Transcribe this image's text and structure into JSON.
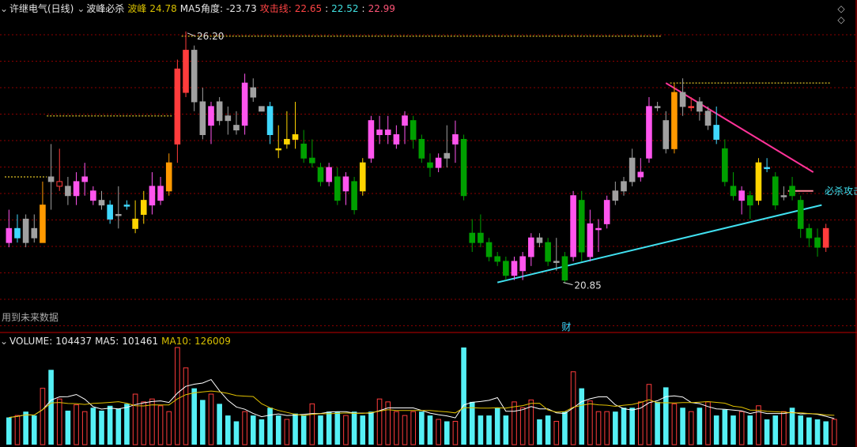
{
  "header": {
    "expand_icon": "chevron-down-icon",
    "stock_name": "许继电气(日线)",
    "indicator_name": "波峰必杀",
    "bofeng_label": "波峰",
    "bofeng_value": "24.78",
    "ma5_label": "MA5角度:",
    "ma5_value": "-23.73",
    "attack_label": "攻击线:",
    "attack_v1": "22.65",
    "attack_v2": "22.52",
    "attack_v3": "22.99"
  },
  "volume_header": {
    "volume_label": "VOLUME:",
    "volume_value": "104437",
    "ma5_label": "MA5:",
    "ma5_value": "101461",
    "ma10_label": "MA10:",
    "ma10_value": "126009"
  },
  "note_text": "用到未来数据",
  "nav": {
    "up": "◇",
    "down": "◇"
  },
  "colors": {
    "up": "#ff3c3c",
    "down": "#00a000",
    "gray": "#a0a0a0",
    "magenta": "#ff55ee",
    "cyan": "#40d8ff",
    "yellow": "#ffd400",
    "orange": "#ff9900",
    "grid": "#8b0000",
    "trend_down": "#ff3399",
    "trend_up": "#40e0f0",
    "level": "#b8a020"
  },
  "chart_data": {
    "type": "candlestick",
    "title": "许继电气(日线)",
    "ylim": [
      19.8,
      26.5
    ],
    "annotations": {
      "high_label": "26.20",
      "low_label": "20.85",
      "cai_label": "财",
      "bisha_label": "必杀攻击"
    },
    "candles": [
      {
        "o": 22.0,
        "h": 22.4,
        "l": 21.6,
        "c": 21.7,
        "t": "magenta"
      },
      {
        "o": 21.8,
        "h": 22.3,
        "l": 21.7,
        "c": 22.0,
        "t": "cyan"
      },
      {
        "o": 21.7,
        "h": 22.3,
        "l": 21.6,
        "c": 22.2,
        "t": "gray"
      },
      {
        "o": 21.8,
        "h": 22.3,
        "l": 21.7,
        "c": 22.0,
        "t": "gray"
      },
      {
        "o": 21.7,
        "h": 23.0,
        "l": 21.7,
        "c": 22.5,
        "t": "orange"
      },
      {
        "o": 23.1,
        "h": 23.8,
        "l": 22.4,
        "c": 23.0,
        "t": "gray"
      },
      {
        "o": 23.0,
        "h": 23.7,
        "l": 22.8,
        "c": 22.9,
        "t": "up"
      },
      {
        "o": 22.9,
        "h": 23.1,
        "l": 22.5,
        "c": 22.7,
        "t": "gray"
      },
      {
        "o": 22.7,
        "h": 23.2,
        "l": 22.5,
        "c": 23.0,
        "t": "magenta"
      },
      {
        "o": 23.0,
        "h": 23.4,
        "l": 22.7,
        "c": 23.1,
        "t": "magenta"
      },
      {
        "o": 22.8,
        "h": 22.9,
        "l": 22.5,
        "c": 22.6,
        "t": "magenta"
      },
      {
        "o": 22.6,
        "h": 22.8,
        "l": 22.4,
        "c": 22.5,
        "t": "gray"
      },
      {
        "o": 22.5,
        "h": 22.6,
        "l": 22.1,
        "c": 22.2,
        "t": "cyan"
      },
      {
        "o": 22.3,
        "h": 22.9,
        "l": 22.0,
        "c": 22.3,
        "t": "gray"
      },
      {
        "o": 22.5,
        "h": 22.6,
        "l": 22.4,
        "c": 22.5,
        "t": "cyan"
      },
      {
        "o": 22.0,
        "h": 22.6,
        "l": 21.9,
        "c": 22.2,
        "t": "yellow"
      },
      {
        "o": 22.3,
        "h": 22.8,
        "l": 22.1,
        "c": 22.6,
        "t": "yellow"
      },
      {
        "o": 22.5,
        "h": 23.2,
        "l": 22.3,
        "c": 22.9,
        "t": "magenta"
      },
      {
        "o": 22.6,
        "h": 23.1,
        "l": 22.5,
        "c": 22.9,
        "t": "magenta"
      },
      {
        "o": 22.8,
        "h": 23.6,
        "l": 22.7,
        "c": 23.4,
        "t": "orange"
      },
      {
        "o": 23.8,
        "h": 25.6,
        "l": 23.4,
        "c": 25.4,
        "t": "up"
      },
      {
        "o": 24.9,
        "h": 26.2,
        "l": 24.8,
        "c": 25.8,
        "t": "up"
      },
      {
        "o": 25.8,
        "h": 25.9,
        "l": 24.5,
        "c": 24.7,
        "t": "gray"
      },
      {
        "o": 24.7,
        "h": 25.0,
        "l": 23.9,
        "c": 24.0,
        "t": "gray"
      },
      {
        "o": 24.2,
        "h": 24.7,
        "l": 23.8,
        "c": 24.6,
        "t": "magenta"
      },
      {
        "o": 24.7,
        "h": 24.8,
        "l": 24.2,
        "c": 24.3,
        "t": "gray"
      },
      {
        "o": 24.3,
        "h": 24.6,
        "l": 24.0,
        "c": 24.4,
        "t": "gray"
      },
      {
        "o": 24.2,
        "h": 24.5,
        "l": 24.0,
        "c": 24.1,
        "t": "gray"
      },
      {
        "o": 24.2,
        "h": 25.3,
        "l": 24.0,
        "c": 25.1,
        "t": "magenta"
      },
      {
        "o": 25.0,
        "h": 25.2,
        "l": 24.7,
        "c": 24.8,
        "t": "gray"
      },
      {
        "o": 24.6,
        "h": 24.6,
        "l": 24.5,
        "c": 24.5,
        "t": "gray"
      },
      {
        "o": 24.6,
        "h": 24.7,
        "l": 23.8,
        "c": 24.0,
        "t": "cyan"
      },
      {
        "o": 23.7,
        "h": 24.2,
        "l": 23.5,
        "c": 23.7,
        "t": "yellow"
      },
      {
        "o": 23.8,
        "h": 24.5,
        "l": 23.7,
        "c": 23.9,
        "t": "yellow"
      },
      {
        "o": 23.9,
        "h": 24.7,
        "l": 23.7,
        "c": 24.0,
        "t": "yellow"
      },
      {
        "o": 23.8,
        "h": 24.1,
        "l": 23.4,
        "c": 23.5,
        "t": "down"
      },
      {
        "o": 23.5,
        "h": 23.9,
        "l": 23.3,
        "c": 23.4,
        "t": "down"
      },
      {
        "o": 23.3,
        "h": 23.4,
        "l": 22.9,
        "c": 23.0,
        "t": "down"
      },
      {
        "o": 23.0,
        "h": 23.4,
        "l": 22.9,
        "c": 23.3,
        "t": "magenta"
      },
      {
        "o": 23.1,
        "h": 23.3,
        "l": 22.5,
        "c": 22.6,
        "t": "down"
      },
      {
        "o": 22.8,
        "h": 23.2,
        "l": 22.5,
        "c": 23.1,
        "t": "magenta"
      },
      {
        "o": 23.0,
        "h": 23.1,
        "l": 22.3,
        "c": 22.4,
        "t": "down"
      },
      {
        "o": 22.8,
        "h": 23.5,
        "l": 22.7,
        "c": 23.4,
        "t": "yellow"
      },
      {
        "o": 23.5,
        "h": 24.4,
        "l": 23.4,
        "c": 24.3,
        "t": "magenta"
      },
      {
        "o": 24.1,
        "h": 24.4,
        "l": 23.8,
        "c": 24.0,
        "t": "magenta"
      },
      {
        "o": 24.0,
        "h": 24.4,
        "l": 23.8,
        "c": 24.1,
        "t": "magenta"
      },
      {
        "o": 24.0,
        "h": 24.2,
        "l": 23.7,
        "c": 23.8,
        "t": "magenta"
      },
      {
        "o": 24.2,
        "h": 24.5,
        "l": 23.8,
        "c": 24.4,
        "t": "magenta"
      },
      {
        "o": 24.3,
        "h": 24.4,
        "l": 23.7,
        "c": 23.9,
        "t": "down"
      },
      {
        "o": 23.9,
        "h": 24.0,
        "l": 23.4,
        "c": 23.5,
        "t": "down"
      },
      {
        "o": 23.4,
        "h": 23.6,
        "l": 23.1,
        "c": 23.3,
        "t": "down"
      },
      {
        "o": 23.3,
        "h": 23.6,
        "l": 23.2,
        "c": 23.5,
        "t": "magenta"
      },
      {
        "o": 23.5,
        "h": 24.2,
        "l": 23.3,
        "c": 23.6,
        "t": "gray"
      },
      {
        "o": 24.0,
        "h": 24.3,
        "l": 23.4,
        "c": 23.8,
        "t": "magenta"
      },
      {
        "o": 23.9,
        "h": 24.0,
        "l": 22.6,
        "c": 22.7,
        "t": "down"
      },
      {
        "o": 21.9,
        "h": 22.2,
        "l": 21.5,
        "c": 21.7,
        "t": "down"
      },
      {
        "o": 21.9,
        "h": 22.3,
        "l": 21.6,
        "c": 21.7,
        "t": "down"
      },
      {
        "o": 21.7,
        "h": 21.8,
        "l": 21.3,
        "c": 21.4,
        "t": "down"
      },
      {
        "o": 21.4,
        "h": 21.5,
        "l": 21.2,
        "c": 21.3,
        "t": "down"
      },
      {
        "o": 21.3,
        "h": 21.4,
        "l": 20.9,
        "c": 21.0,
        "t": "down"
      },
      {
        "o": 21.0,
        "h": 21.4,
        "l": 20.9,
        "c": 21.3,
        "t": "magenta"
      },
      {
        "o": 21.1,
        "h": 21.5,
        "l": 20.9,
        "c": 21.4,
        "t": "magenta"
      },
      {
        "o": 21.4,
        "h": 21.9,
        "l": 21.2,
        "c": 21.8,
        "t": "magenta"
      },
      {
        "o": 21.8,
        "h": 21.9,
        "l": 21.6,
        "c": 21.7,
        "t": "gray"
      },
      {
        "o": 21.7,
        "h": 21.8,
        "l": 21.2,
        "c": 21.3,
        "t": "down"
      },
      {
        "o": 21.3,
        "h": 21.8,
        "l": 21.1,
        "c": 21.3,
        "t": "gray"
      },
      {
        "o": 21.4,
        "h": 21.5,
        "l": 20.85,
        "c": 20.9,
        "t": "down"
      },
      {
        "o": 21.4,
        "h": 22.8,
        "l": 21.3,
        "c": 22.7,
        "t": "magenta"
      },
      {
        "o": 22.6,
        "h": 22.8,
        "l": 21.3,
        "c": 21.5,
        "t": "down"
      },
      {
        "o": 21.4,
        "h": 22.4,
        "l": 21.3,
        "c": 22.1,
        "t": "magenta"
      },
      {
        "o": 22.0,
        "h": 22.2,
        "l": 21.5,
        "c": 22.0,
        "t": "magenta"
      },
      {
        "o": 22.1,
        "h": 22.7,
        "l": 22.0,
        "c": 22.6,
        "t": "magenta"
      },
      {
        "o": 22.6,
        "h": 23.0,
        "l": 22.5,
        "c": 22.8,
        "t": "gray"
      },
      {
        "o": 22.8,
        "h": 23.1,
        "l": 22.7,
        "c": 23.0,
        "t": "gray"
      },
      {
        "o": 23.0,
        "h": 23.7,
        "l": 22.9,
        "c": 23.5,
        "t": "gray"
      },
      {
        "o": 23.1,
        "h": 23.5,
        "l": 23.0,
        "c": 23.2,
        "t": "magenta"
      },
      {
        "o": 23.5,
        "h": 24.8,
        "l": 23.4,
        "c": 24.6,
        "t": "magenta"
      },
      {
        "o": 24.6,
        "h": 24.7,
        "l": 24.5,
        "c": 24.6,
        "t": "gray"
      },
      {
        "o": 23.7,
        "h": 24.5,
        "l": 23.6,
        "c": 24.3,
        "t": "gray"
      },
      {
        "o": 23.7,
        "h": 25.1,
        "l": 23.6,
        "c": 24.9,
        "t": "orange"
      },
      {
        "o": 24.9,
        "h": 25.2,
        "l": 24.4,
        "c": 24.6,
        "t": "gray"
      },
      {
        "o": 24.6,
        "h": 24.8,
        "l": 24.5,
        "c": 24.6,
        "t": "up"
      },
      {
        "o": 24.7,
        "h": 24.8,
        "l": 24.3,
        "c": 24.5,
        "t": "gray"
      },
      {
        "o": 24.5,
        "h": 24.6,
        "l": 24.1,
        "c": 24.2,
        "t": "gray"
      },
      {
        "o": 24.2,
        "h": 24.6,
        "l": 23.8,
        "c": 23.9,
        "t": "cyan"
      },
      {
        "o": 23.7,
        "h": 23.9,
        "l": 22.9,
        "c": 23.0,
        "t": "down"
      },
      {
        "o": 22.9,
        "h": 23.2,
        "l": 22.6,
        "c": 22.7,
        "t": "down"
      },
      {
        "o": 22.6,
        "h": 22.9,
        "l": 22.3,
        "c": 22.8,
        "t": "magenta"
      },
      {
        "o": 22.7,
        "h": 22.8,
        "l": 22.2,
        "c": 22.5,
        "t": "down"
      },
      {
        "o": 22.6,
        "h": 23.5,
        "l": 22.5,
        "c": 23.4,
        "t": "yellow"
      },
      {
        "o": 23.3,
        "h": 23.5,
        "l": 23.2,
        "c": 23.3,
        "t": "cyan"
      },
      {
        "o": 23.1,
        "h": 23.2,
        "l": 22.4,
        "c": 22.5,
        "t": "down"
      },
      {
        "o": 22.7,
        "h": 22.9,
        "l": 22.6,
        "c": 22.7,
        "t": "gray"
      },
      {
        "o": 22.9,
        "h": 23.1,
        "l": 22.6,
        "c": 22.7,
        "t": "down"
      },
      {
        "o": 22.6,
        "h": 22.7,
        "l": 21.8,
        "c": 22.0,
        "t": "down"
      },
      {
        "o": 22.0,
        "h": 22.1,
        "l": 21.6,
        "c": 21.8,
        "t": "down"
      },
      {
        "o": 21.8,
        "h": 22.0,
        "l": 21.4,
        "c": 21.6,
        "t": "down"
      },
      {
        "o": 21.6,
        "h": 22.1,
        "l": 21.5,
        "c": 22.0,
        "t": "up"
      }
    ],
    "volume": [
      {
        "v": 0.28,
        "t": "cyan"
      },
      {
        "v": 0.3,
        "t": "up"
      },
      {
        "v": 0.34,
        "t": "cyan"
      },
      {
        "v": 0.3,
        "t": "cyan"
      },
      {
        "v": 0.58,
        "t": "up"
      },
      {
        "v": 0.77,
        "t": "cyan"
      },
      {
        "v": 0.47,
        "t": "up"
      },
      {
        "v": 0.35,
        "t": "cyan"
      },
      {
        "v": 0.41,
        "t": "up"
      },
      {
        "v": 0.34,
        "t": "up"
      },
      {
        "v": 0.38,
        "t": "cyan"
      },
      {
        "v": 0.35,
        "t": "cyan"
      },
      {
        "v": 0.4,
        "t": "cyan"
      },
      {
        "v": 0.37,
        "t": "cyan"
      },
      {
        "v": 0.42,
        "t": "cyan"
      },
      {
        "v": 0.52,
        "t": "up"
      },
      {
        "v": 0.44,
        "t": "up"
      },
      {
        "v": 0.47,
        "t": "up"
      },
      {
        "v": 0.4,
        "t": "up"
      },
      {
        "v": 0.34,
        "t": "up"
      },
      {
        "v": 1.0,
        "t": "up"
      },
      {
        "v": 0.79,
        "t": "up"
      },
      {
        "v": 0.58,
        "t": "cyan"
      },
      {
        "v": 0.46,
        "t": "cyan"
      },
      {
        "v": 0.52,
        "t": "up"
      },
      {
        "v": 0.42,
        "t": "cyan"
      },
      {
        "v": 0.3,
        "t": "cyan"
      },
      {
        "v": 0.24,
        "t": "cyan"
      },
      {
        "v": 0.34,
        "t": "up"
      },
      {
        "v": 0.3,
        "t": "cyan"
      },
      {
        "v": 0.26,
        "t": "cyan"
      },
      {
        "v": 0.38,
        "t": "cyan"
      },
      {
        "v": 0.3,
        "t": "cyan"
      },
      {
        "v": 0.26,
        "t": "up"
      },
      {
        "v": 0.32,
        "t": "cyan"
      },
      {
        "v": 0.3,
        "t": "cyan"
      },
      {
        "v": 0.42,
        "t": "up"
      },
      {
        "v": 0.3,
        "t": "cyan"
      },
      {
        "v": 0.34,
        "t": "cyan"
      },
      {
        "v": 0.34,
        "t": "cyan"
      },
      {
        "v": 0.3,
        "t": "up"
      },
      {
        "v": 0.34,
        "t": "cyan"
      },
      {
        "v": 0.3,
        "t": "cyan"
      },
      {
        "v": 0.34,
        "t": "cyan"
      },
      {
        "v": 0.47,
        "t": "up"
      },
      {
        "v": 0.44,
        "t": "up"
      },
      {
        "v": 0.34,
        "t": "up"
      },
      {
        "v": 0.3,
        "t": "up"
      },
      {
        "v": 0.34,
        "t": "up"
      },
      {
        "v": 0.34,
        "t": "cyan"
      },
      {
        "v": 0.3,
        "t": "cyan"
      },
      {
        "v": 0.26,
        "t": "up"
      },
      {
        "v": 0.24,
        "t": "cyan"
      },
      {
        "v": 0.24,
        "t": "up"
      },
      {
        "v": 1.0,
        "t": "cyan"
      },
      {
        "v": 0.44,
        "t": "cyan"
      },
      {
        "v": 0.3,
        "t": "cyan"
      },
      {
        "v": 0.3,
        "t": "cyan"
      },
      {
        "v": 0.38,
        "t": "cyan"
      },
      {
        "v": 0.3,
        "t": "cyan"
      },
      {
        "v": 0.44,
        "t": "up"
      },
      {
        "v": 0.38,
        "t": "up"
      },
      {
        "v": 0.46,
        "t": "up"
      },
      {
        "v": 0.26,
        "t": "cyan"
      },
      {
        "v": 0.3,
        "t": "cyan"
      },
      {
        "v": 0.24,
        "t": "up"
      },
      {
        "v": 0.34,
        "t": "cyan"
      },
      {
        "v": 0.75,
        "t": "up"
      },
      {
        "v": 0.58,
        "t": "cyan"
      },
      {
        "v": 0.45,
        "t": "up"
      },
      {
        "v": 0.34,
        "t": "up"
      },
      {
        "v": 0.34,
        "t": "up"
      },
      {
        "v": 0.34,
        "t": "cyan"
      },
      {
        "v": 0.38,
        "t": "cyan"
      },
      {
        "v": 0.38,
        "t": "cyan"
      },
      {
        "v": 0.44,
        "t": "up"
      },
      {
        "v": 0.62,
        "t": "up"
      },
      {
        "v": 0.44,
        "t": "cyan"
      },
      {
        "v": 0.59,
        "t": "cyan"
      },
      {
        "v": 0.42,
        "t": "up"
      },
      {
        "v": 0.38,
        "t": "cyan"
      },
      {
        "v": 0.34,
        "t": "up"
      },
      {
        "v": 0.38,
        "t": "cyan"
      },
      {
        "v": 0.44,
        "t": "up"
      },
      {
        "v": 0.3,
        "t": "cyan"
      },
      {
        "v": 0.36,
        "t": "cyan"
      },
      {
        "v": 0.3,
        "t": "cyan"
      },
      {
        "v": 0.34,
        "t": "up"
      },
      {
        "v": 0.3,
        "t": "cyan"
      },
      {
        "v": 0.4,
        "t": "up"
      },
      {
        "v": 0.26,
        "t": "cyan"
      },
      {
        "v": 0.3,
        "t": "cyan"
      },
      {
        "v": 0.34,
        "t": "up"
      },
      {
        "v": 0.38,
        "t": "cyan"
      },
      {
        "v": 0.3,
        "t": "cyan"
      },
      {
        "v": 0.28,
        "t": "cyan"
      },
      {
        "v": 0.26,
        "t": "cyan"
      },
      {
        "v": 0.24,
        "t": "cyan"
      },
      {
        "v": 0.26,
        "t": "up"
      }
    ]
  }
}
